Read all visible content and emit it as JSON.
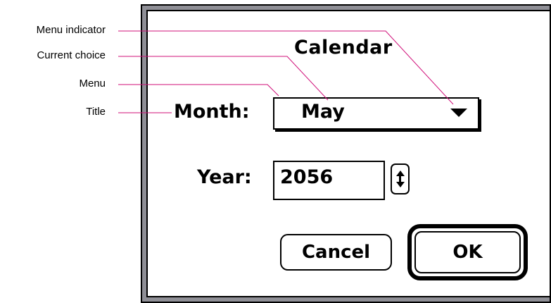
{
  "annotations": {
    "menu_indicator": "Menu indicator",
    "current_choice": "Current choice",
    "menu": "Menu",
    "title": "Title"
  },
  "dialog": {
    "title": "Calendar",
    "month_label": "Month:",
    "month_value": "May",
    "year_label": "Year:",
    "year_value": "2056",
    "cancel_label": "Cancel",
    "ok_label": "OK"
  },
  "colors": {
    "leader_line": "#d0107a",
    "window_frame": "#8f8f96",
    "text": "#000000"
  },
  "icons": {
    "menu_indicator": "triangle-down-icon",
    "stepper": "up-down-arrows-icon"
  }
}
